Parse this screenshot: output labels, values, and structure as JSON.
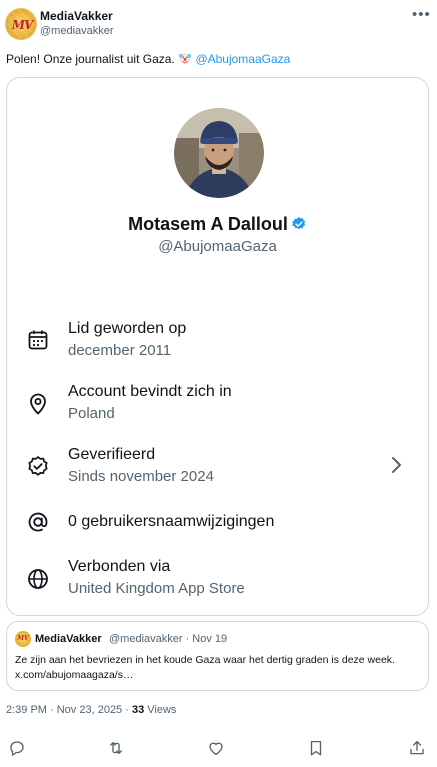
{
  "author": {
    "name": "MediaVakker",
    "handle": "@mediavakker",
    "avatar_text": "MV"
  },
  "more_icon": "more-horizontal-icon",
  "tweet": {
    "text": "Polen! Onze journalist uit Gaza. ",
    "emoji": "clown-emoji",
    "mention": "@AbujomaaGaza"
  },
  "profile_card": {
    "name": "Motasem A Dalloul",
    "handle": "@AbujomaaGaza",
    "verified_color": "#1d9bf0",
    "rows": [
      {
        "icon": "calendar-icon",
        "title": "Lid geworden op",
        "subtitle": "december 2011"
      },
      {
        "icon": "location-pin-icon",
        "title": "Account bevindt zich in",
        "subtitle": "Poland"
      },
      {
        "icon": "verified-badge-icon",
        "title": "Geverifieerd",
        "subtitle": "Sinds november 2024",
        "has_chevron": true
      },
      {
        "icon": "at-sign-icon",
        "title": "0 gebruikersnaamwijzigingen",
        "subtitle": ""
      },
      {
        "icon": "globe-icon",
        "title": "Verbonden via",
        "subtitle": "United Kingdom App Store"
      }
    ]
  },
  "quote": {
    "name": "MediaVakker",
    "meta": "@mediavakker · Nov 19",
    "avatar_text": "MV",
    "text": "Ze zijn aan het bevriezen in het koude Gaza waar het dertig graden is deze week. x.com/abujomaagaza/s…"
  },
  "footer": {
    "time": "2:39 PM · Nov 23, 2025 · ",
    "views_count": "33",
    "views_label": " Views"
  },
  "actions": [
    "reply-icon",
    "retweet-icon",
    "like-icon",
    "bookmark-icon",
    "share-icon"
  ],
  "colors": {
    "accent": "#1d9bf0",
    "text": "#0f1419",
    "muted": "#536471",
    "border": "#cfd9de"
  }
}
